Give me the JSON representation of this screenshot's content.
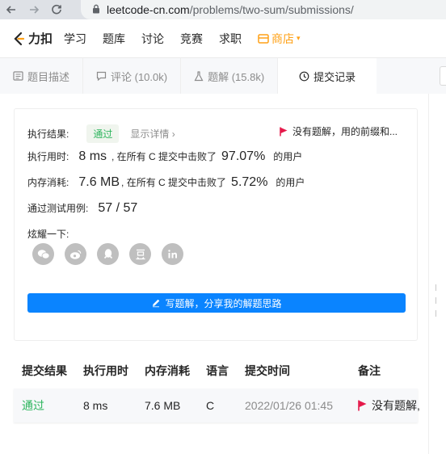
{
  "browser": {
    "url_host": "leetcode-cn.com",
    "url_path": "/problems/two-sum/submissions/"
  },
  "site_nav": {
    "logo_text": "力扣",
    "items": [
      "学习",
      "题库",
      "讨论",
      "竞赛",
      "求职"
    ],
    "shop_label": "商店",
    "accent_color": "#ffa116"
  },
  "tabs": [
    {
      "label": "题目描述",
      "icon": "document-icon"
    },
    {
      "label": "评论 (10.0k)",
      "icon": "comment-icon"
    },
    {
      "label": "题解 (15.8k)",
      "icon": "flask-icon"
    },
    {
      "label": "提交记录",
      "icon": "clock-icon",
      "active": true
    }
  ],
  "result": {
    "status_label": "执行结果:",
    "status_value": "通过",
    "detail_link": "显示详情 ›",
    "note_text": "没有题解，用的前缀和...",
    "runtime_label": "执行用时:",
    "runtime_value": "8 ms",
    "runtime_beat_text": ", 在所有 C 提交中击败了",
    "runtime_pct": "97.07%",
    "runtime_suffix": "的用户",
    "memory_label": "内存消耗:",
    "memory_value": "7.6 MB",
    "memory_beat_text": ", 在所有 C 提交中击败了",
    "memory_pct": "5.72%",
    "memory_suffix": "的用户",
    "tests_label": "通过测试用例:",
    "tests_value": "57 / 57",
    "share_label": "炫耀一下:",
    "share_icons": [
      {
        "name": "wechat-icon",
        "glyph": "微"
      },
      {
        "name": "weibo-icon",
        "glyph": "博"
      },
      {
        "name": "qq-icon",
        "glyph": "Q"
      },
      {
        "name": "douban-icon",
        "glyph": "豆"
      },
      {
        "name": "linkedin-icon",
        "glyph": "in"
      }
    ],
    "write_button": "写题解，分享我的解题思路"
  },
  "table": {
    "headers": [
      "提交结果",
      "执行用时",
      "内存消耗",
      "语言",
      "提交时间",
      "备注"
    ],
    "rows": [
      {
        "result": "通过",
        "runtime": "8 ms",
        "memory": "7.6 MB",
        "lang": "C",
        "time": "2022/01/26 01:45",
        "note": "没有题解,"
      }
    ]
  }
}
